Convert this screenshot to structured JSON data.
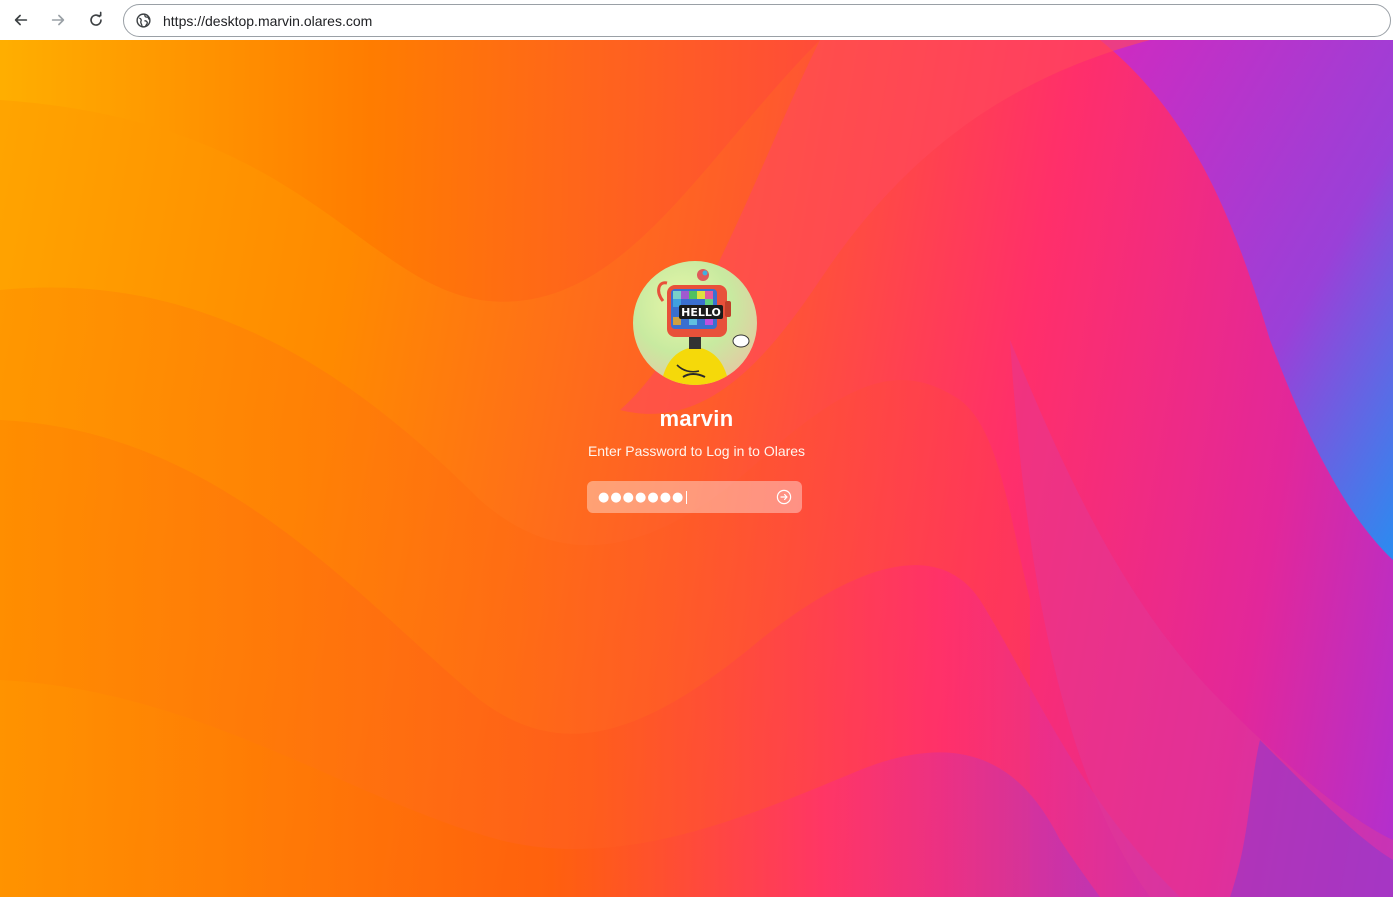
{
  "browser": {
    "url": "https://desktop.marvin.olares.com",
    "back_icon": "arrow-left-icon",
    "forward_icon": "arrow-right-icon",
    "reload_icon": "reload-icon",
    "site_icon": "globe-icon"
  },
  "login": {
    "username": "marvin",
    "prompt": "Enter Password to Log in to Olares",
    "password_masked": "●●●●●●●",
    "submit_icon": "circle-arrow-right-icon",
    "avatar_text": "HELLO"
  },
  "colors": {
    "wallpaper_start": "#ffa500",
    "wallpaper_mid": "#ff5c2a",
    "wallpaper_pink": "#ff2f6a",
    "wallpaper_end": "#b030d0"
  }
}
